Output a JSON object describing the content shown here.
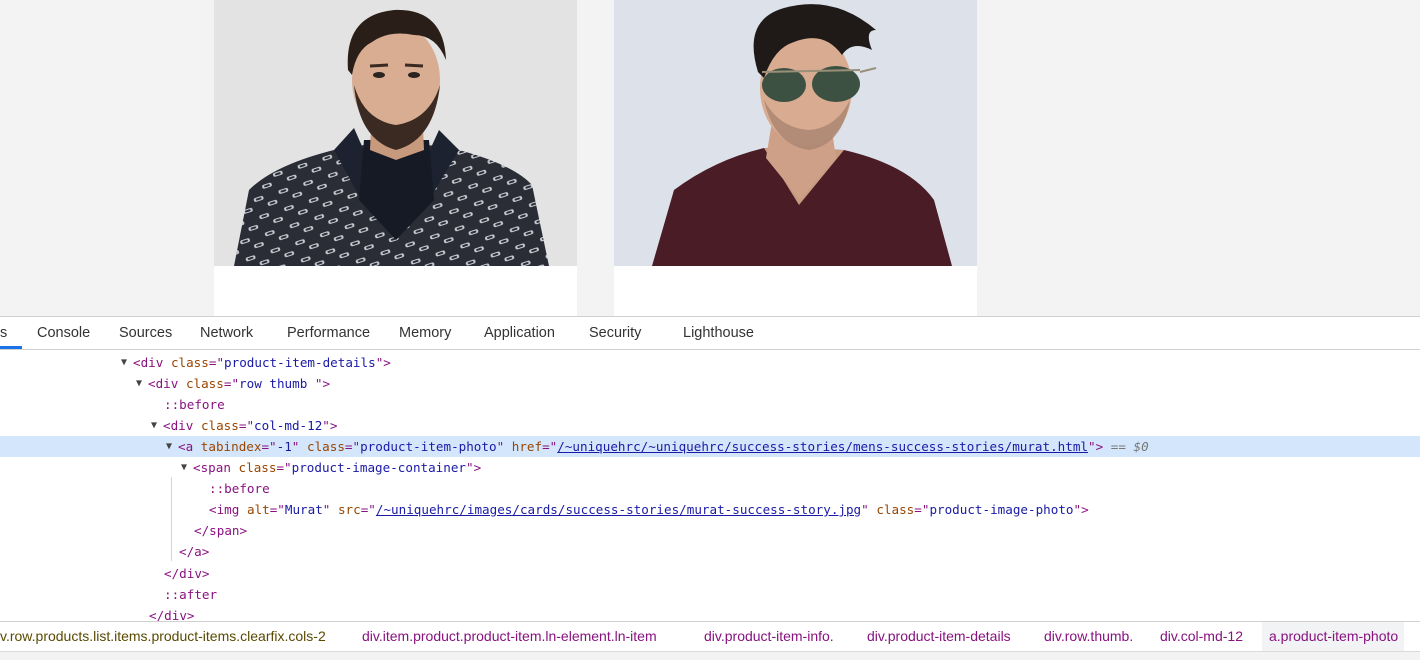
{
  "page": {
    "cards": [
      {
        "alt": "Murat"
      },
      {
        "alt": ""
      }
    ]
  },
  "devtools": {
    "tabs": [
      {
        "label": "s"
      },
      {
        "label": "Console"
      },
      {
        "label": "Sources"
      },
      {
        "label": "Network"
      },
      {
        "label": "Performance"
      },
      {
        "label": "Memory"
      },
      {
        "label": "Application"
      },
      {
        "label": "Security"
      },
      {
        "label": "Lighthouse"
      }
    ],
    "active_tab_accent": "#1a73e8",
    "tree": {
      "r1": {
        "tag": "div",
        "attr": "class",
        "value": "product-item-details"
      },
      "r2": {
        "tag": "div",
        "attr": "class",
        "value": "row thumb "
      },
      "r3": {
        "pseudo": "::before"
      },
      "r4": {
        "tag": "div",
        "attr": "class",
        "value": "col-md-12"
      },
      "r5": {
        "tag": "a",
        "attr1": "tabindex",
        "value1": "-1",
        "attr2": "class",
        "value2": "product-item-photo",
        "attr3": "href",
        "value3": "/~uniquehrc/~uniquehrc/success-stories/mens-success-stories/murat.html",
        "dollar": "== $0"
      },
      "r6": {
        "tag": "span",
        "attr": "class",
        "value": "product-image-container"
      },
      "r7": {
        "pseudo": "::before"
      },
      "r8": {
        "tag": "img",
        "attr1": "alt",
        "value1": "Murat",
        "attr2": "src",
        "value2": "/~uniquehrc/images/cards/success-stories/murat-success-story.jpg",
        "attr3": "class",
        "value3": "product-image-photo"
      },
      "r9": {
        "close": "</span>"
      },
      "r10": {
        "close": "</a>"
      },
      "r11": {
        "close": "</div>"
      },
      "r12": {
        "pseudo": "::after"
      },
      "r13": {
        "close": "</div>"
      }
    },
    "breadcrumbs": [
      {
        "label": "v.row.products.list.items.product-items.clearfix.cols-2"
      },
      {
        "label": "div.item.product.product-item.ln-element.ln-item"
      },
      {
        "label": "div.product-item-info."
      },
      {
        "label": "div.product-item-details"
      },
      {
        "label": "div.row.thumb."
      },
      {
        "label": "div.col-md-12"
      },
      {
        "label": "a.product-item-photo"
      }
    ]
  }
}
